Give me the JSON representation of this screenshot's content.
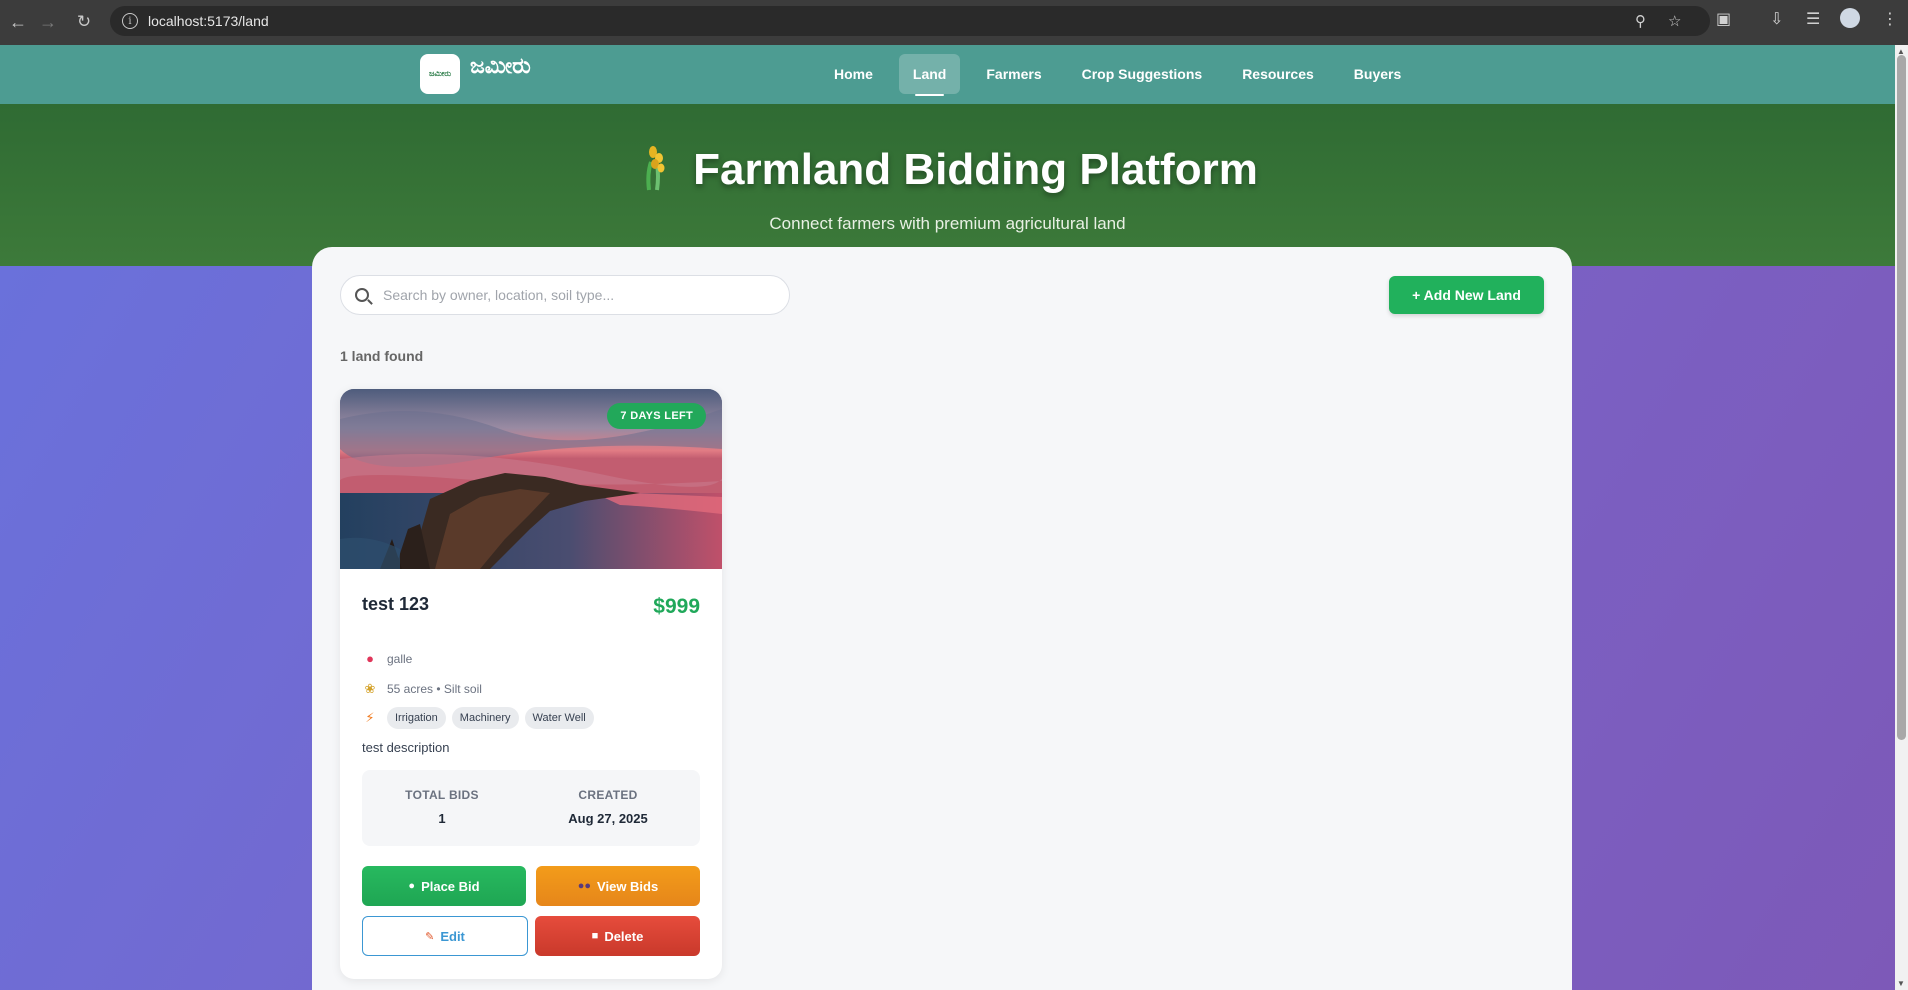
{
  "browser": {
    "url": "localhost:5173/land",
    "back_icon": "arrow-left-icon",
    "forward_icon": "arrow-right-icon",
    "reload_icon": "reload-icon"
  },
  "nav": {
    "logo_text": "ಜಮೀರು",
    "logo_small": "ಜಮೀರು",
    "links": [
      {
        "label": "Home",
        "active": false
      },
      {
        "label": "Land",
        "active": true
      },
      {
        "label": "Farmers",
        "active": false
      },
      {
        "label": "Crop Suggestions",
        "active": false
      },
      {
        "label": "Resources",
        "active": false
      },
      {
        "label": "Buyers",
        "active": false
      }
    ]
  },
  "hero": {
    "title": "Farmland Bidding Platform",
    "subtitle": "Connect farmers with premium agricultural land"
  },
  "toolbar": {
    "search_placeholder": "Search by owner, location, soil type...",
    "add_label": "+ Add New Land"
  },
  "results": {
    "count_text": "1 land found"
  },
  "card": {
    "badge": "7 DAYS LEFT",
    "title": "test 123",
    "price": "$999",
    "location": "galle",
    "size_soil": "55 acres • Silt soil",
    "features": [
      "Irrigation",
      "Machinery",
      "Water Well"
    ],
    "description": "test description",
    "stats": {
      "bids_label": "TOTAL BIDS",
      "bids_value": "1",
      "created_label": "CREATED",
      "created_value": "Aug 27, 2025"
    },
    "buttons": {
      "place_bid": "Place Bid",
      "view_bids": "View Bids",
      "edit": "Edit",
      "delete": "Delete"
    }
  },
  "colors": {
    "nav_bg": "#4d9c92",
    "hero_bg": "#2f6b33",
    "accent_green": "#21b15c",
    "orange": "#f39c1a",
    "red": "#e64c3c",
    "blue": "#3b97d3"
  }
}
